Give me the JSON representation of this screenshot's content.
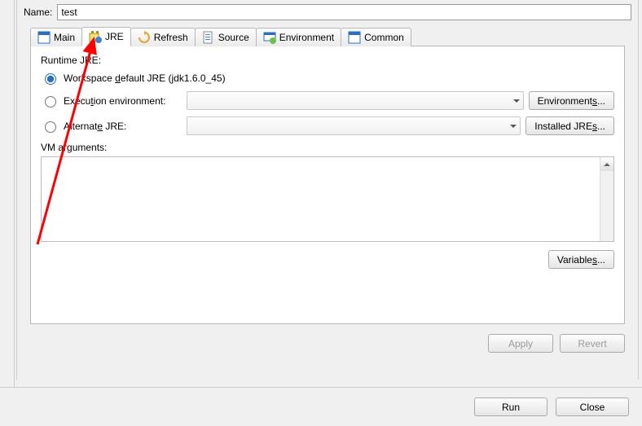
{
  "name": {
    "label": "Name:",
    "value": "test"
  },
  "tabs": {
    "main": "Main",
    "jre": "JRE",
    "refresh": "Refresh",
    "source": "Source",
    "environment": "Environment",
    "common": "Common"
  },
  "jrePanel": {
    "sectionTitle": "Runtime JRE:",
    "workspaceDefault": {
      "pre": "Workspace ",
      "u": "d",
      "post": "efault JRE (jdk1.6.0_45)"
    },
    "executionEnv": {
      "pre": "Execu",
      "u": "t",
      "post": "ion environment:"
    },
    "alternateJre": {
      "pre": "Alternat",
      "u": "e",
      "post": " JRE:"
    },
    "environmentsBtn": {
      "text": "Environment",
      "u": "s",
      "after": "..."
    },
    "installedJresBtn": {
      "text": "Installed JRE",
      "u": "s",
      "after": "..."
    },
    "vmArgsLabel": {
      "pre": "VM ar",
      "u": "g",
      "post": "uments:"
    },
    "vmArgsValue": "",
    "variablesBtn": {
      "text": "Variable",
      "u": "s",
      "after": "..."
    }
  },
  "panelButtons": {
    "apply": "Apply",
    "revert": "Revert"
  },
  "bottomButtons": {
    "run": "Run",
    "close": "Close"
  }
}
